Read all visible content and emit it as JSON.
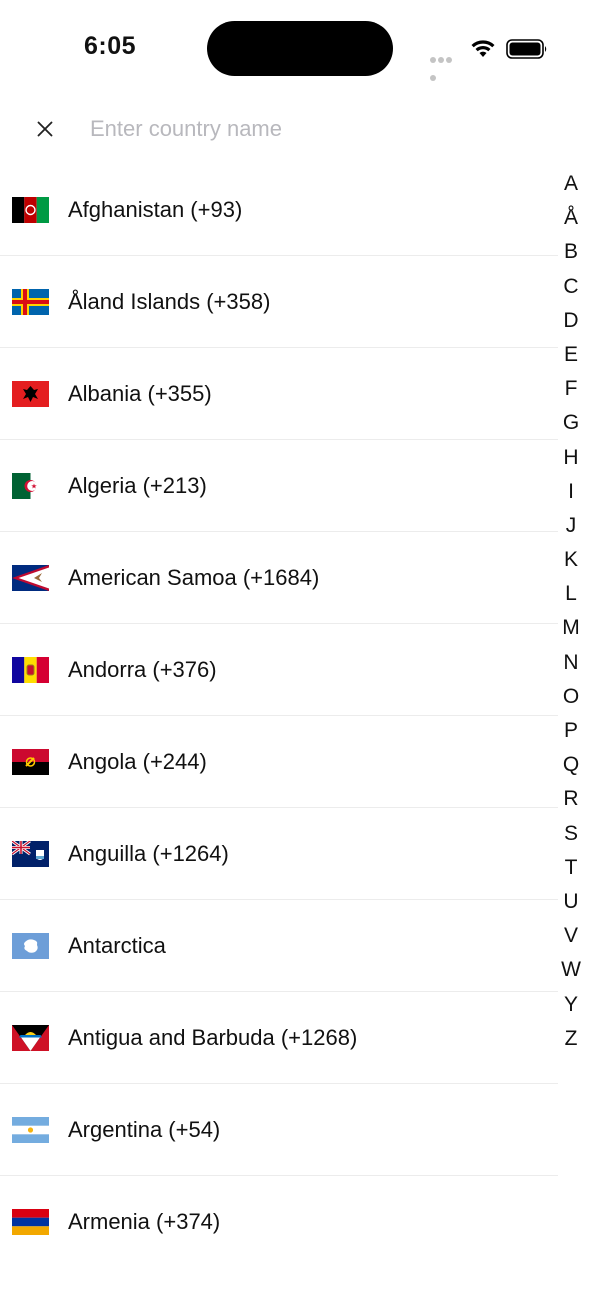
{
  "status_bar": {
    "time": "6:05"
  },
  "search": {
    "placeholder": "Enter country name",
    "close_icon": "close-icon"
  },
  "countries": [
    {
      "label": "Afghanistan (+93)",
      "flag": "afghanistan-flag"
    },
    {
      "label": "Åland Islands (+358)",
      "flag": "aland-flag"
    },
    {
      "label": "Albania (+355)",
      "flag": "albania-flag"
    },
    {
      "label": "Algeria (+213)",
      "flag": "algeria-flag"
    },
    {
      "label": "American Samoa (+1684)",
      "flag": "american-samoa-flag"
    },
    {
      "label": "Andorra (+376)",
      "flag": "andorra-flag"
    },
    {
      "label": "Angola (+244)",
      "flag": "angola-flag"
    },
    {
      "label": "Anguilla (+1264)",
      "flag": "anguilla-flag"
    },
    {
      "label": "Antarctica",
      "flag": "antarctica-flag"
    },
    {
      "label": "Antigua and Barbuda (+1268)",
      "flag": "antigua-flag"
    },
    {
      "label": "Argentina (+54)",
      "flag": "argentina-flag"
    },
    {
      "label": "Armenia (+374)",
      "flag": "armenia-flag"
    }
  ],
  "index_letters": [
    "A",
    "Å",
    "B",
    "C",
    "D",
    "E",
    "F",
    "G",
    "H",
    "I",
    "J",
    "K",
    "L",
    "M",
    "N",
    "O",
    "P",
    "Q",
    "R",
    "S",
    "T",
    "U",
    "V",
    "W",
    "Y",
    "Z"
  ]
}
